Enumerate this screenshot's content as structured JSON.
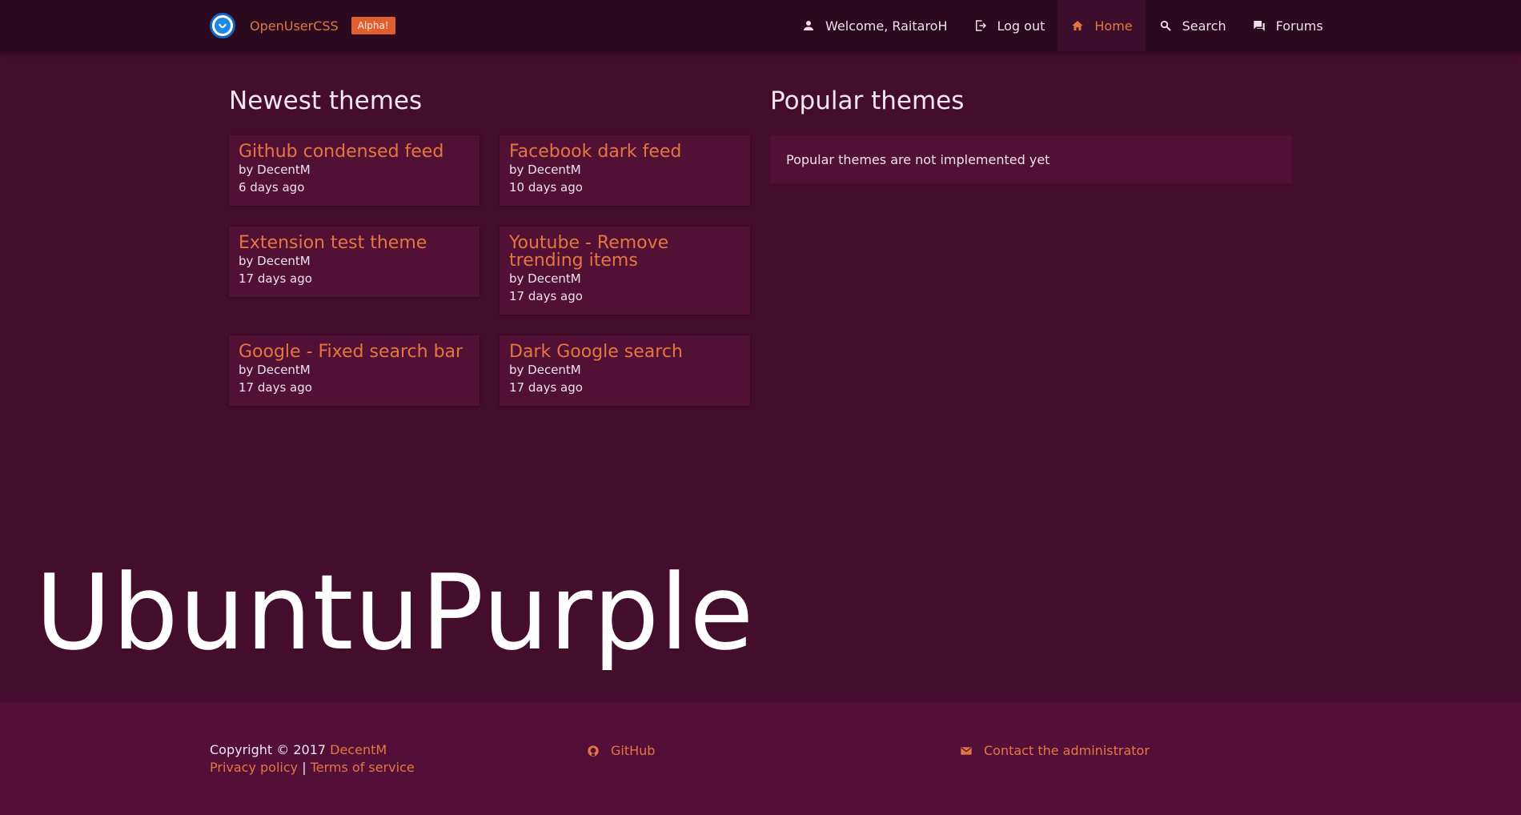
{
  "brand": {
    "name": "OpenUserCSS",
    "badge": "Alpha!"
  },
  "nav": {
    "welcome": "Welcome, RaitaroH",
    "logout": "Log out",
    "home": "Home",
    "search": "Search",
    "forums": "Forums"
  },
  "newest": {
    "title": "Newest themes",
    "themes": [
      {
        "title": "Github condensed feed",
        "author": "by DecentM",
        "time": "6 days ago"
      },
      {
        "title": "Facebook dark feed",
        "author": "by DecentM",
        "time": "10 days ago"
      },
      {
        "title": "Extension test theme",
        "author": "by DecentM",
        "time": "17 days ago"
      },
      {
        "title": "Youtube - Remove trending items",
        "author": "by DecentM",
        "time": "17 days ago"
      },
      {
        "title": "Google - Fixed search bar",
        "author": "by DecentM",
        "time": "17 days ago"
      },
      {
        "title": "Dark Google search",
        "author": "by DecentM",
        "time": "17 days ago"
      }
    ]
  },
  "popular": {
    "title": "Popular themes",
    "message": "Popular themes are not implemented yet"
  },
  "watermark": "UbuntuPurple",
  "footer": {
    "copyright": "Copyright © 2017",
    "author_link": "DecentM",
    "privacy": "Privacy policy",
    "separator": "|",
    "terms": "Terms of service",
    "github": "GitHub",
    "contact": "Contact the administrator"
  },
  "colors": {
    "background": "#430d2b",
    "navbar": "#2b0a1f",
    "card": "#521034",
    "accent": "#e37741",
    "footer": "#530f37"
  }
}
